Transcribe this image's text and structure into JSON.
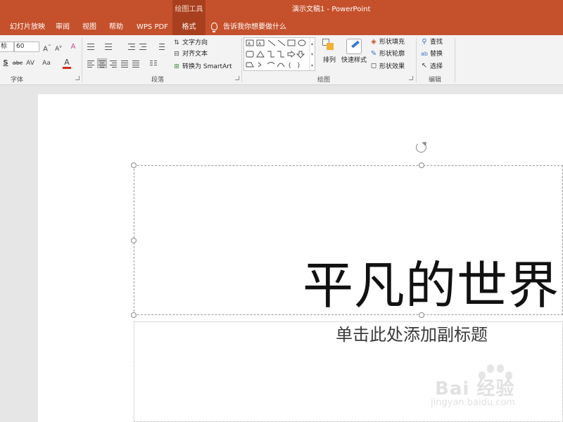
{
  "titlebar": {
    "context_tool": "绘图工具",
    "title": "演示文稿1  -  PowerPoint"
  },
  "tabs": [
    {
      "label": "幻灯片放映"
    },
    {
      "label": "审阅"
    },
    {
      "label": "视图"
    },
    {
      "label": "帮助"
    },
    {
      "label": "WPS PDF"
    },
    {
      "label": "格式"
    }
  ],
  "tellme": "告诉我你想要做什么",
  "font_group": {
    "font_name": "标",
    "font_size": "60",
    "label": "字体"
  },
  "paragraph_group": {
    "text_direction": "文字方向",
    "align_text": "对齐文本",
    "convert_smartart": "转换为 SmartArt",
    "label": "段落"
  },
  "drawing_group": {
    "arrange": "排列",
    "quick_styles": "快速样式",
    "shape_fill": "形状填充",
    "shape_outline": "形状轮廓",
    "shape_effects": "形状效果",
    "label": "绘图"
  },
  "editing_group": {
    "find": "查找",
    "replace": "替换",
    "select": "选择",
    "label": "编辑"
  },
  "slide": {
    "title": "平凡的世界",
    "subtitle": "单击此处添加副标题"
  },
  "watermark": {
    "main": "Bai 经验",
    "sub": "jingyan.baidu.com"
  },
  "colors": {
    "accent": "#c5512c",
    "accent_dark": "#a8401f",
    "font_color_bar": "#d62a1f"
  }
}
